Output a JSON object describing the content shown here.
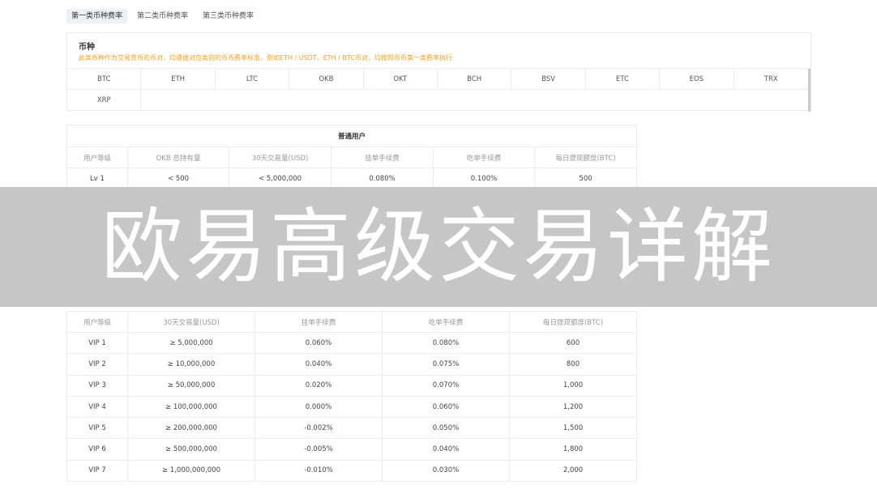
{
  "tabs": [
    "第一类币种费率",
    "第二类币种费率",
    "第三类币种费率"
  ],
  "coin_panel": {
    "title": "币种",
    "note": "此类币种作为交易货币的币对，均遵循对应类别的币币费率标准，例如ETH / USDT、ETH / BTC币对，均按照币币第一类费率执行",
    "row1": [
      "BTC",
      "ETH",
      "LTC",
      "OKB",
      "OKT",
      "BCH",
      "BSV",
      "ETC",
      "EOS",
      "TRX"
    ],
    "row2": [
      "XRP",
      "",
      "",
      "",
      "",
      "",
      "",
      "",
      "",
      ""
    ]
  },
  "normal_table": {
    "caption": "普通用户",
    "headers": [
      "用户等级",
      "OKB 总持有量",
      "30天交易量(USD)",
      "挂单手续费",
      "吃单手续费",
      "每日提现额度(BTC)"
    ],
    "rows": [
      [
        "Lv 1",
        "< 500",
        "< 5,000,000",
        "0.080%",
        "0.100%",
        "500"
      ]
    ]
  },
  "vip_table": {
    "headers": [
      "用户等级",
      "30天交易量(USD)",
      "挂单手续费",
      "吃单手续费",
      "每日提现额度(BTC)"
    ],
    "rows": [
      [
        "VIP 1",
        "≥ 5,000,000",
        "0.060%",
        "0.080%",
        "600"
      ],
      [
        "VIP 2",
        "≥ 10,000,000",
        "0.040%",
        "0.075%",
        "800"
      ],
      [
        "VIP 3",
        "≥ 50,000,000",
        "0.020%",
        "0.070%",
        "1,000"
      ],
      [
        "VIP 4",
        "≥ 100,000,000",
        "0.000%",
        "0.060%",
        "1,200"
      ],
      [
        "VIP 5",
        "≥ 200,000,000",
        "-0.002%",
        "0.050%",
        "1,500"
      ],
      [
        "VIP 6",
        "≥ 500,000,000",
        "-0.005%",
        "0.040%",
        "1,800"
      ],
      [
        "VIP 7",
        "≥ 1,000,000,000",
        "-0.010%",
        "0.030%",
        "2,000"
      ]
    ]
  },
  "banner": {
    "text": "欧易高级交易详解"
  },
  "colors": {
    "note": "#f0a020",
    "banner_bg": "#c6c6c6",
    "active_tab_bg": "#eef0f6"
  }
}
